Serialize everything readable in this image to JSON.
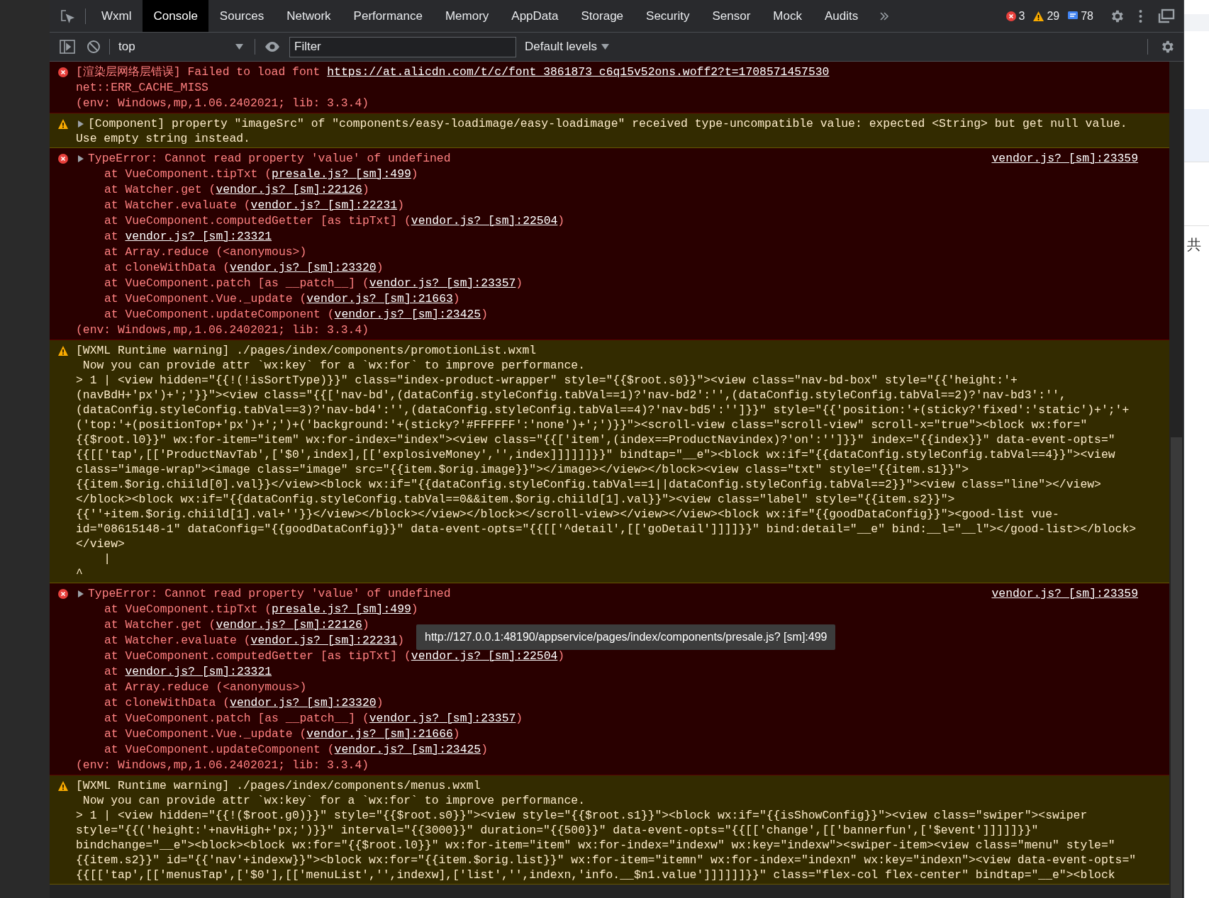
{
  "tabs": [
    {
      "label": "Wxml",
      "selected": false
    },
    {
      "label": "Console",
      "selected": true
    },
    {
      "label": "Sources",
      "selected": false
    },
    {
      "label": "Network",
      "selected": false
    },
    {
      "label": "Performance",
      "selected": false
    },
    {
      "label": "Memory",
      "selected": false
    },
    {
      "label": "AppData",
      "selected": false
    },
    {
      "label": "Storage",
      "selected": false
    },
    {
      "label": "Security",
      "selected": false
    },
    {
      "label": "Sensor",
      "selected": false
    },
    {
      "label": "Mock",
      "selected": false
    },
    {
      "label": "Audits",
      "selected": false
    }
  ],
  "counts": {
    "errors": "3",
    "warnings": "29",
    "info": "78"
  },
  "filter_bar": {
    "context": "top",
    "filter": {
      "placeholder": "Filter"
    },
    "levels": "Default levels"
  },
  "messages": [
    {
      "kind": "error",
      "expandable": false,
      "lines": [
        [
          "[渲染层网络层错误] Failed to load font ",
          {
            "link": "https://at.alicdn.com/t/c/font_3861873_c6q15v52ons.woff2?t=1708571457530"
          }
        ],
        "net::ERR_CACHE_MISS",
        "(env: Windows,mp,1.06.2402021; lib: 3.3.4)"
      ]
    },
    {
      "kind": "warning",
      "expandable": true,
      "lines": [
        "[Component] property \"imageSrc\" of \"components/easy-loadimage/easy-loadimage\" received type-uncompatible value: expected <String> but get null value.",
        "Use empty string instead."
      ]
    },
    {
      "kind": "error",
      "expandable": true,
      "source": "vendor.js? [sm]:23359",
      "lines": [
        "TypeError: Cannot read property 'value' of undefined"
      ],
      "frames": [
        [
          "at VueComponent.tipTxt (",
          {
            "link": "presale.js? [sm]:499"
          },
          ")"
        ],
        [
          "at Watcher.get (",
          {
            "link": "vendor.js? [sm]:22126"
          },
          ")"
        ],
        [
          "at Watcher.evaluate (",
          {
            "link": "vendor.js? [sm]:22231"
          },
          ")"
        ],
        [
          "at VueComponent.computedGetter [as tipTxt] (",
          {
            "link": "vendor.js? [sm]:22504"
          },
          ")"
        ],
        [
          "at ",
          {
            "link": "vendor.js? [sm]:23321"
          }
        ],
        [
          "at Array.reduce (<anonymous>)"
        ],
        [
          "at cloneWithData (",
          {
            "link": "vendor.js? [sm]:23320"
          },
          ")"
        ],
        [
          "at VueComponent.patch [as __patch__] (",
          {
            "link": "vendor.js? [sm]:23357"
          },
          ")"
        ],
        [
          "at VueComponent.Vue._update (",
          {
            "link": "vendor.js? [sm]:21663"
          },
          ")"
        ],
        [
          "at VueComponent.updateComponent (",
          {
            "link": "vendor.js? [sm]:23425"
          },
          ")"
        ]
      ],
      "footer": "(env: Windows,mp,1.06.2402021; lib: 3.3.4)"
    },
    {
      "kind": "warning",
      "expandable": false,
      "lines": [
        "[WXML Runtime warning] ./pages/index/components/promotionList.wxml",
        " Now you can provide attr `wx:key` for a `wx:for` to improve performance.",
        "> 1 | <view hidden=\"{{!(!isSortType)}}\" class=\"index-product-wrapper\" style=\"{{$root.s0}}\"><view class=\"nav-bd-box\" style=\"{{'height:'+",
        "(navBdH+'px')+';'}}\"><view class=\"{{['nav-bd',(dataConfig.styleConfig.tabVal==1)?'nav-bd2':'',(dataConfig.styleConfig.tabVal==2)?'nav-bd3':'',",
        "(dataConfig.styleConfig.tabVal==3)?'nav-bd4':'',(dataConfig.styleConfig.tabVal==4)?'nav-bd5':'']}}\" style=\"{{'position:'+(sticky?'fixed':'static')+';'+",
        "('top:'+(positionTop+'px')+';')+('background:'+(sticky?'#FFFFFF':'none')+';')}}\"><scroll-view class=\"scroll-view\" scroll-x=\"true\"><block wx:for=\"",
        "{{$root.l0}}\" wx:for-item=\"item\" wx:for-index=\"index\"><view class=\"{{['item',(index==ProductNavindex)?'on':'']}}\" index=\"{{index}}\" data-event-opts=\"",
        "{{[['tap',[['ProductNavTab',['$0',index],[['explosiveMoney','',index]]]]]]}}\" bindtap=\"__e\"><block wx:if=\"{{dataConfig.styleConfig.tabVal==4}}\"><view",
        "class=\"image-wrap\"><image class=\"image\" src=\"{{item.$orig.image}}\"></image></view></block><view class=\"txt\" style=\"{{item.s1}}\">",
        "{{item.$orig.chiild[0].val}}</view><block wx:if=\"{{dataConfig.styleConfig.tabVal==1||dataConfig.styleConfig.tabVal==2}}\"><view class=\"line\"></view>",
        "</block><block wx:if=\"{{dataConfig.styleConfig.tabVal==0&&item.$orig.chiild[1].val}}\"><view class=\"label\" style=\"{{item.s2}}\">",
        "{{''+item.$orig.chiild[1].val+''}}</view></block></view></block></scroll-view></view></view><block wx:if=\"{{goodDataConfig}}\"><good-list vue-",
        "id=\"08615148-1\" dataConfig=\"{{goodDataConfig}}\" data-event-opts=\"{{[['^detail',[['goDetail']]]]}}\" bind:detail=\"__e\" bind:__l=\"__l\"></good-list></block>",
        "</view>",
        "    |",
        "^"
      ]
    },
    {
      "kind": "error",
      "expandable": true,
      "source": "vendor.js? [sm]:23359",
      "tooltip": "http://127.0.0.1:48190/appservice/pages/index/components/presale.js? [sm]:499",
      "lines": [
        "TypeError: Cannot read property 'value' of undefined"
      ],
      "frames": [
        [
          "at VueComponent.tipTxt (",
          {
            "link": "presale.js? [sm]:499"
          },
          ")"
        ],
        [
          "at Watcher.get (",
          {
            "link": "vendor.js? [sm]:22126"
          },
          ")"
        ],
        [
          "at Watcher.evaluate (",
          {
            "link": "vendor.js? [sm]:22231"
          },
          ")"
        ],
        [
          "at VueComponent.computedGetter [as tipTxt] (",
          {
            "link": "vendor.js? [sm]:22504"
          },
          ")"
        ],
        [
          "at ",
          {
            "link": "vendor.js? [sm]:23321"
          }
        ],
        [
          "at Array.reduce (<anonymous>)"
        ],
        [
          "at cloneWithData (",
          {
            "link": "vendor.js? [sm]:23320"
          },
          ")"
        ],
        [
          "at VueComponent.patch [as __patch__] (",
          {
            "link": "vendor.js? [sm]:23357"
          },
          ")"
        ],
        [
          "at VueComponent.Vue._update (",
          {
            "link": "vendor.js? [sm]:21666"
          },
          ")"
        ],
        [
          "at VueComponent.updateComponent (",
          {
            "link": "vendor.js? [sm]:23425"
          },
          ")"
        ]
      ],
      "footer": "(env: Windows,mp,1.06.2402021; lib: 3.3.4)"
    },
    {
      "kind": "warning",
      "expandable": false,
      "lines": [
        "[WXML Runtime warning] ./pages/index/components/menus.wxml",
        " Now you can provide attr `wx:key` for a `wx:for` to improve performance.",
        "> 1 | <view hidden=\"{{!($root.g0)}}\" style=\"{{$root.s0}}\"><view style=\"{{$root.s1}}\"><block wx:if=\"{{isShowConfig}}\"><view class=\"swiper\"><swiper",
        "style=\"{{('height:'+navHigh+'px;')}}\" interval=\"{{3000}}\" duration=\"{{500}}\" data-event-opts=\"{{[['change',[['bannerfun',['$event']]]]]}}\"",
        "bindchange=\"__e\"><block><block wx:for=\"{{$root.l0}}\" wx:for-item=\"item\" wx:for-index=\"indexw\" wx:key=\"indexw\"><swiper-item><view class=\"menu\" style=\"",
        "{{item.s2}}\" id=\"{{'nav'+indexw}}\"><block wx:for=\"{{item.$orig.list}}\" wx:for-item=\"itemn\" wx:for-index=\"indexn\" wx:key=\"indexn\"><view data-event-opts=\"",
        "{{[['tap',[['menusTap',['$0'],[['menuList','',indexw],['list','',indexn,'info.__$n1.value']]]]]]}}\" class=\"flex-col flex-center\" bindtap=\"__e\"><block"
      ]
    }
  ],
  "side_panel": {
    "text": "共"
  }
}
